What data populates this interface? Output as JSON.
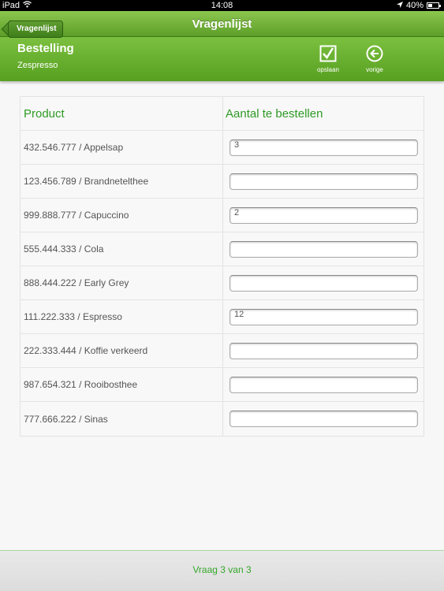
{
  "status_bar": {
    "device": "iPad",
    "time": "14:08",
    "battery_percent_label": "40%",
    "battery_level": 0.4,
    "wifi_icon": "wifi-icon",
    "location_icon": "location-arrow-icon"
  },
  "nav": {
    "back_label": "Vragenlijst",
    "title": "Vragenlijst"
  },
  "subheader": {
    "title": "Bestelling",
    "subtitle": "Zespresso",
    "actions": [
      {
        "label": "opslaan",
        "icon": "checkbox-icon"
      },
      {
        "label": "vorige",
        "icon": "circle-arrow-left-icon"
      }
    ]
  },
  "table": {
    "headers": {
      "product": "Product",
      "quantity": "Aantal te bestellen"
    },
    "rows": [
      {
        "product": "432.546.777 / Appelsap",
        "quantity": "3"
      },
      {
        "product": "123.456.789 / Brandnetelthee",
        "quantity": ""
      },
      {
        "product": "999.888.777 / Capuccino",
        "quantity": "2"
      },
      {
        "product": "555.444.333 / Cola",
        "quantity": ""
      },
      {
        "product": "888.444.222 / Early Grey",
        "quantity": ""
      },
      {
        "product": "111.222.333 / Espresso",
        "quantity": "12"
      },
      {
        "product": "222.333.444 / Koffie verkeerd",
        "quantity": ""
      },
      {
        "product": "987.654.321 / Rooibosthee",
        "quantity": ""
      },
      {
        "product": "777.666.222 / Sinas",
        "quantity": ""
      }
    ]
  },
  "footer": {
    "progress_text": "Vraag 3 van 3"
  },
  "colors": {
    "brand_green": "#6cb232",
    "header_text_green": "#2e9a25",
    "footer_text_green": "#35a72c"
  }
}
